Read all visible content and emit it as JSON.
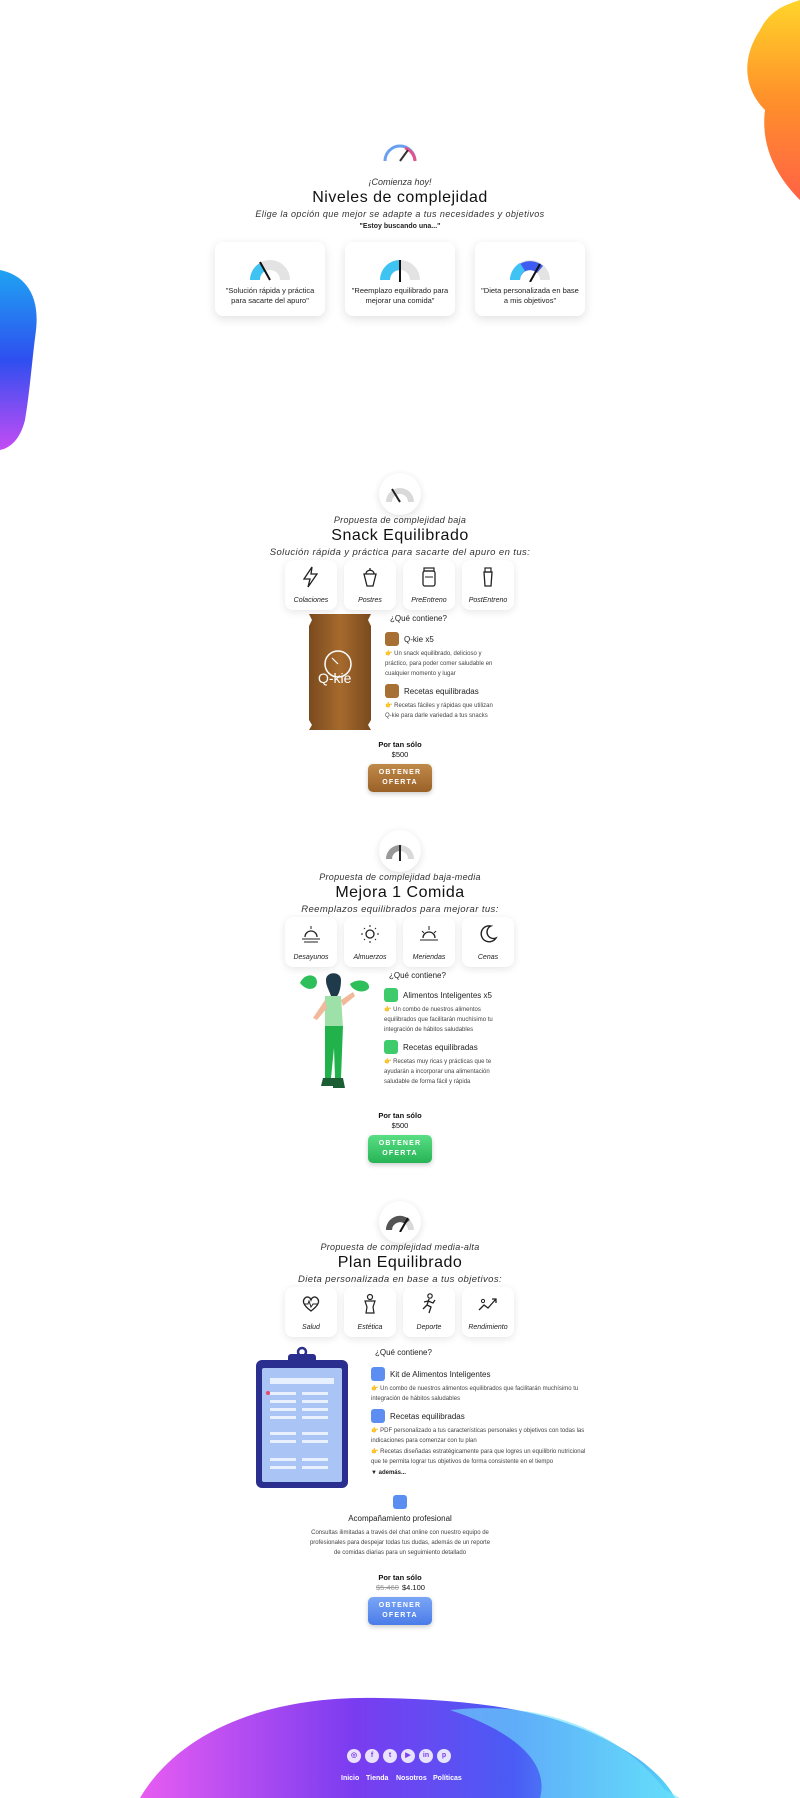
{
  "intro": {
    "kicker": "¡Comienza hoy!",
    "title": "Niveles de complejidad",
    "subtitle": "Elige la opción que mejor se adapte a tus necesidades y objetivos",
    "looking": "\"Estoy buscando una...\""
  },
  "levels": [
    {
      "text": "\"Solución rápida y práctica para sacarte del apuro\""
    },
    {
      "text": "\"Reemplazo equilibrado para mejorar una comida\""
    },
    {
      "text": "\"Dieta personalizada en base a mis objetivos\""
    }
  ],
  "snack": {
    "kicker": "Propuesta de complejidad baja",
    "title": "Snack Equilibrado",
    "desc": "Solución rápida y práctica para sacarte del apuro en tus:",
    "categories": [
      "Colaciones",
      "Postres",
      "PreEntreno",
      "PostEntreno"
    ],
    "contains": "¿Qué contiene?",
    "items": [
      {
        "title": "Q-kie x5",
        "desc": "👉 Un snack equilibrado, delicioso y práctico, para poder comer saludable en cualquier momento y lugar"
      },
      {
        "title": "Recetas equilibradas",
        "desc": "👉 Recetas fáciles y rápidas que utilizan Q-kie para darle variedad a tus snacks"
      }
    ],
    "product_label": "Q-kie",
    "price_label": "Por tan sólo",
    "price": "$500",
    "button": "OBTENER OFERTA"
  },
  "meal": {
    "kicker": "Propuesta de complejidad baja-media",
    "title": "Mejora 1 Comida",
    "desc": "Reemplazos equilibrados para mejorar tus:",
    "categories": [
      "Desayunos",
      "Almuerzos",
      "Meriendas",
      "Cenas"
    ],
    "contains": "¿Qué contiene?",
    "items": [
      {
        "title": "Alimentos Inteligentes x5",
        "desc": "👉 Un combo de nuestros alimentos equilibrados que facilitarán muchísimo tu integración de hábitos saludables"
      },
      {
        "title": "Recetas equilibradas",
        "desc": "👉 Recetas muy ricas y prácticas que te ayudarán a incorporar una alimentación saludable de forma fácil y rápida"
      }
    ],
    "price_label": "Por tan sólo",
    "price": "$500",
    "button": "OBTENER OFERTA"
  },
  "plan": {
    "kicker": "Propuesta de complejidad media-alta",
    "title": "Plan Equilibrado",
    "desc": "Dieta personalizada en base a tus objetivos:",
    "categories": [
      "Salud",
      "Estética",
      "Deporte",
      "Rendimiento"
    ],
    "contains": "¿Qué contiene?",
    "items": [
      {
        "title": "Kit de Alimentos Inteligentes",
        "desc": "👉 Un combo de nuestros alimentos equilibrados que facilitarán muchísimo tu integración de hábitos saludables"
      },
      {
        "title": "Recetas equilibradas",
        "desc": "👉 PDF personalizado a tus características personales y objetivos con todas las indicaciones para comenzar con tu plan",
        "desc2": "👉 Recetas diseñadas estratégicamente para que logres un equilibrio nutricional que te permita lograr tus objetivos de forma consistente en el tiempo"
      }
    ],
    "more": "▼ además...",
    "extra_title": "Acompañamiento profesional",
    "extra_desc": "Consultas ilimitadas a través del chat online con nuestro equipo de profesionales para despejar todas tus dudas, además de un reporte de comidas diarias para un seguimiento detallado",
    "price_label": "Por tan sólo",
    "old_price": "$5.460",
    "price": "$4.100",
    "button": "OBTENER OFERTA"
  },
  "footer": {
    "social": [
      {
        "icon": "instagram-icon",
        "glyph": "◎"
      },
      {
        "icon": "facebook-icon",
        "glyph": "f"
      },
      {
        "icon": "twitter-icon",
        "glyph": "t"
      },
      {
        "icon": "youtube-icon",
        "glyph": "▶"
      },
      {
        "icon": "linkedin-icon",
        "glyph": "in"
      },
      {
        "icon": "pinterest-icon",
        "glyph": "p"
      }
    ],
    "links": [
      "Inicio",
      "Tienda",
      "Nosotros",
      "Políticas"
    ]
  },
  "colors": {
    "snack_button": "#a86f35",
    "meal_button": "#35c46a",
    "plan_button": "#5b8ef0"
  }
}
